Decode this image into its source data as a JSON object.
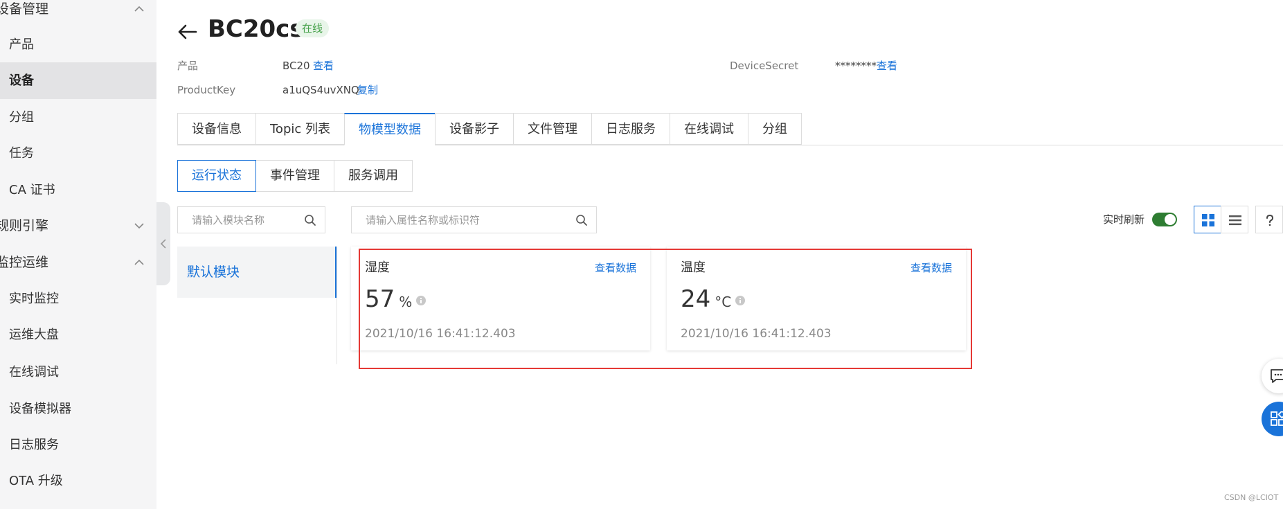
{
  "sidebar": {
    "groups": [
      {
        "label": "设备管理",
        "expanded": true
      },
      {
        "label": "规则引擎",
        "expanded": false
      },
      {
        "label": "监控运维",
        "expanded": true
      }
    ],
    "device_items": [
      "产品",
      "设备",
      "分组",
      "任务",
      "CA 证书"
    ],
    "ops_items": [
      "实时监控",
      "运维大盘",
      "在线调试",
      "设备模拟器",
      "日志服务",
      "OTA 升级"
    ],
    "active_item": "设备"
  },
  "header": {
    "device_name": "BC20cs",
    "status": "在线"
  },
  "meta": {
    "product_label": "产品",
    "product_value": "BC20",
    "product_link": "查看",
    "productkey_label": "ProductKey",
    "productkey_value": "a1uQS4uvXNQ",
    "productkey_link": "复制",
    "secret_label": "DeviceSecret",
    "secret_value": "********",
    "secret_link": "查看"
  },
  "tabs": [
    "设备信息",
    "Topic 列表",
    "物模型数据",
    "设备影子",
    "文件管理",
    "日志服务",
    "在线调试",
    "分组"
  ],
  "active_tab": "物模型数据",
  "subtabs": [
    "运行状态",
    "事件管理",
    "服务调用"
  ],
  "active_subtab": "运行状态",
  "module_search": {
    "placeholder": "请输入模块名称"
  },
  "property_search": {
    "placeholder": "请输入属性名称或标识符"
  },
  "modules": [
    "默认模块"
  ],
  "toolbar": {
    "realtime_label": "实时刷新",
    "realtime_on": true,
    "view": "grid"
  },
  "cards": [
    {
      "title": "湿度",
      "link": "查看数据",
      "value": "57",
      "unit": "%",
      "time": "2021/10/16 16:41:12.403"
    },
    {
      "title": "温度",
      "link": "查看数据",
      "value": "24",
      "unit": "°C",
      "time": "2021/10/16 16:41:12.403"
    }
  ],
  "watermark": "CSDN @LCIOT",
  "colors": {
    "accent": "#1a73d9",
    "online": "#43a047",
    "highlight": "#e53935",
    "toggle": "#2e7d32"
  }
}
